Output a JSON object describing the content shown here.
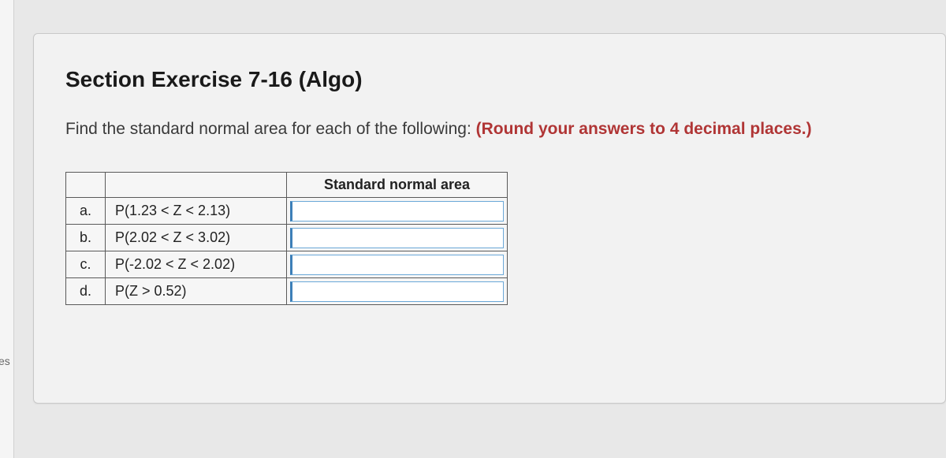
{
  "sidebar": {
    "fragment_text": "es"
  },
  "card": {
    "title": "Section Exercise 7-16 (Algo)",
    "prompt_plain": "Find the standard normal area for each of the following: ",
    "prompt_bold": "(Round your answers to 4 decimal places.)"
  },
  "table": {
    "header_answer": "Standard normal area",
    "rows": [
      {
        "label": "a.",
        "expr": "P(1.23 < Z < 2.13)",
        "value": ""
      },
      {
        "label": "b.",
        "expr": "P(2.02 < Z < 3.02)",
        "value": ""
      },
      {
        "label": "c.",
        "expr": "P(-2.02 < Z < 2.02)",
        "value": ""
      },
      {
        "label": "d.",
        "expr": "P(Z > 0.52)",
        "value": ""
      }
    ]
  }
}
